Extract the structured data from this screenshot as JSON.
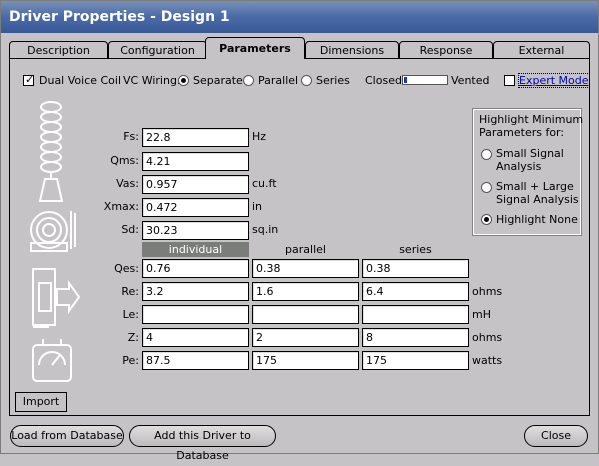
{
  "window": {
    "title": "Driver Properties - Design 1"
  },
  "tabs": [
    "Description",
    "Configuration",
    "Parameters",
    "Dimensions",
    "Response",
    "External"
  ],
  "active_tab": "Parameters",
  "options": {
    "dual_voice_coil_label": "Dual Voice Coil",
    "dual_voice_coil_checked": true,
    "vc_wiring_label": "VC Wiring:",
    "vc_wiring": [
      "Separate",
      "Parallel",
      "Series"
    ],
    "vc_wiring_selected": "Separate",
    "closed_label": "Closed",
    "vented_label": "Vented",
    "closed_vented_level": 0.05,
    "expert_mode_label": "Expert Mode",
    "expert_mode_checked": false
  },
  "params": [
    {
      "label": "Fs:",
      "value": "22.8",
      "unit": "Hz"
    },
    {
      "label": "Qms:",
      "value": "4.21",
      "unit": ""
    },
    {
      "label": "Vas:",
      "value": "0.957",
      "unit": "cu.ft"
    },
    {
      "label": "Xmax:",
      "value": "0.472",
      "unit": "in"
    },
    {
      "label": "Sd:",
      "value": "30.23",
      "unit": "sq.in"
    }
  ],
  "columns": [
    "individual",
    "parallel",
    "series"
  ],
  "active_column": "individual",
  "vc_params": [
    {
      "label": "Qes:",
      "values": [
        "0.76",
        "0.38",
        "0.38"
      ],
      "unit": ""
    },
    {
      "label": "Re:",
      "values": [
        "3.2",
        "1.6",
        "6.4"
      ],
      "unit": "ohms"
    },
    {
      "label": "Le:",
      "values": [
        "",
        "",
        ""
      ],
      "unit": "mH"
    },
    {
      "label": "Z:",
      "values": [
        "4",
        "2",
        "8"
      ],
      "unit": "ohms"
    },
    {
      "label": "Pe:",
      "values": [
        "87.5",
        "175",
        "175"
      ],
      "unit": "watts"
    }
  ],
  "highlight": {
    "title_line1": "Highlight Minimum",
    "title_line2": "Parameters for:",
    "options": [
      {
        "line1": "Small Signal",
        "line2": "Analysis"
      },
      {
        "line1": "Small + Large",
        "line2": "Signal Analysis"
      },
      {
        "line1": "Highlight None",
        "line2": ""
      }
    ],
    "selected_index": 2
  },
  "buttons": {
    "import": "Import",
    "load_from_db": "Load from Database",
    "add_to_db": "Add this Driver to Database",
    "close": "Close"
  },
  "icons": [
    "coil-icon",
    "cone-icon",
    "speaker-front-icon",
    "motor-icon",
    "meter-icon"
  ]
}
